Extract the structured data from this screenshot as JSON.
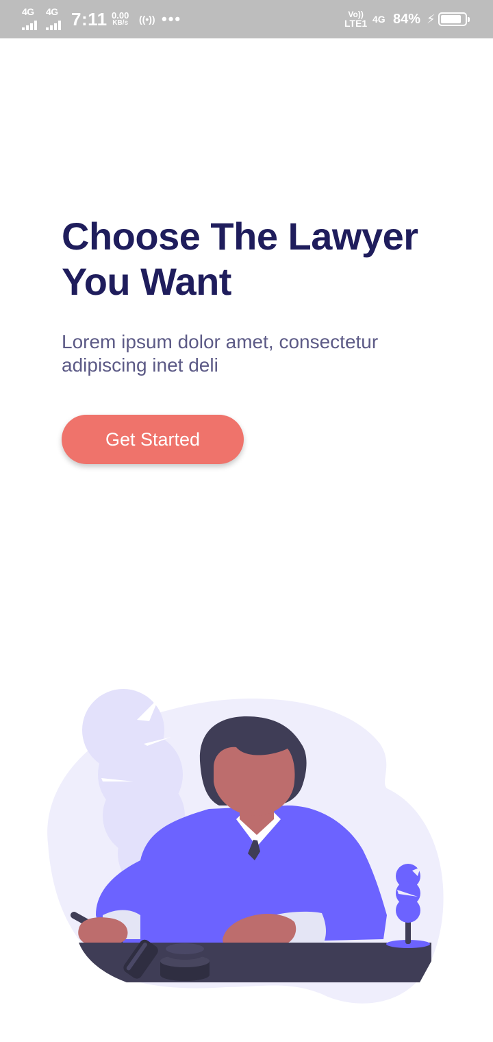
{
  "status_bar": {
    "signal1_label": "4G",
    "signal2_label": "4G",
    "time": "7:11",
    "speed_value": "0.00",
    "speed_unit": "KB/s",
    "hotspot_glyph": "((•))",
    "more_glyph": "•••",
    "volte_top": "Vo))",
    "volte_bottom": "LTE1",
    "network_type": "4G",
    "battery_percent": "84%",
    "battery_level": 0.84,
    "charging_glyph": "⚡"
  },
  "onboarding": {
    "title": "Choose The Lawyer You Want",
    "subtitle": "Lorem ipsum dolor amet, consectetur adipiscing inet deli",
    "cta_label": "Get Started"
  },
  "icons": {
    "hotspot": "hotspot-icon",
    "more": "more-icon",
    "charging": "charging-icon",
    "battery": "battery-icon",
    "signal": "signal-icon"
  },
  "colors": {
    "status_bar": "#bdbdbd",
    "title": "#1f1d5c",
    "subtitle": "#5c5a86",
    "cta": "#ef736b",
    "accent_purple": "#6c63ff",
    "dark_navy": "#3f3d56",
    "skin": "#bd6d6d",
    "blob_light": "#efeefc"
  }
}
